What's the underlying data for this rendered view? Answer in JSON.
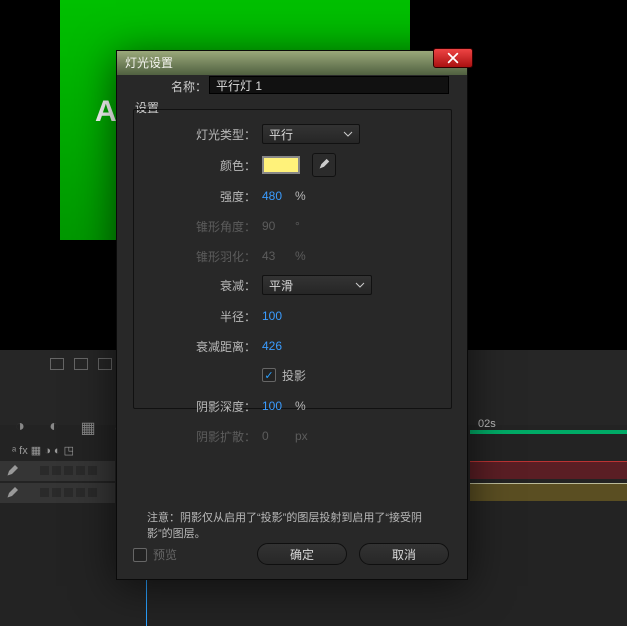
{
  "workspace": {
    "comp_letter": "A",
    "time_marker": "02s",
    "header_symbols": "ᵃ fx ▦ ◑ ◐ ◳"
  },
  "dialog": {
    "title": "灯光设置",
    "name_label": "名称：",
    "name_value": "平行灯 1",
    "section_title": "设置",
    "rows": {
      "type": {
        "label": "灯光类型：",
        "value": "平行"
      },
      "color": {
        "label": "颜色：",
        "swatch": "#fff27a"
      },
      "intensity": {
        "label": "强度：",
        "value": "480",
        "suffix": "%"
      },
      "cone_angle": {
        "label": "锥形角度：",
        "value": "90",
        "suffix": "°"
      },
      "cone_feather": {
        "label": "锥形羽化：",
        "value": "43",
        "suffix": "%"
      },
      "falloff": {
        "label": "衰减：",
        "value": "平滑"
      },
      "radius": {
        "label": "半径：",
        "value": "100"
      },
      "falloff_dist": {
        "label": "衰减距离：",
        "value": "426"
      },
      "cast_shadow": {
        "label": "投影",
        "checked": true
      },
      "shadow_dark": {
        "label": "阴影深度：",
        "value": "100",
        "suffix": "%"
      },
      "shadow_diff": {
        "label": "阴影扩散：",
        "value": "0",
        "suffix": "px"
      }
    },
    "note": "注意：阴影仅从启用了“投影”的图层投射到启用了“接受阴影”的图层。",
    "preview_label": "预览",
    "ok": "确定",
    "cancel": "取消"
  }
}
